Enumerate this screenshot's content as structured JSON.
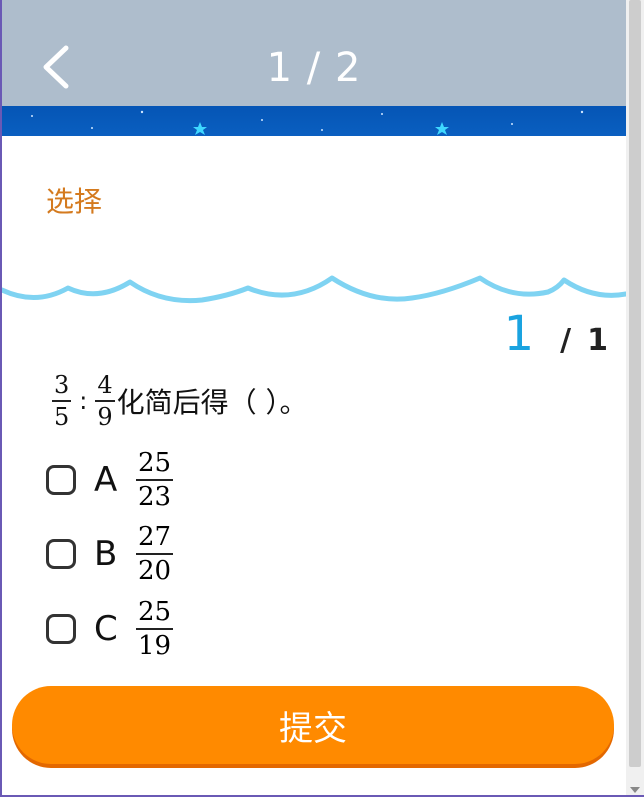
{
  "header": {
    "page_indicator": "1 / 2"
  },
  "section": {
    "title": "选择"
  },
  "counter": {
    "current": "1",
    "separator": "/",
    "total": "1"
  },
  "question": {
    "frac1": {
      "num": "3",
      "den": "5"
    },
    "colon": ":",
    "frac2": {
      "num": "4",
      "den": "9"
    },
    "text": "化简后得（   ）。"
  },
  "options": [
    {
      "letter": "A",
      "num": "25",
      "den": "23"
    },
    {
      "letter": "B",
      "num": "27",
      "den": "20"
    },
    {
      "letter": "C",
      "num": "25",
      "den": "19"
    }
  ],
  "submit_label": "提交",
  "colors": {
    "header_bg": "#aebdcc",
    "section_title": "#d47a1e",
    "wave": "#7fd3f2",
    "counter_current": "#1aa3e0",
    "submit_bg": "#ff8a00"
  },
  "icons": {
    "back": "chevron-left-icon"
  }
}
